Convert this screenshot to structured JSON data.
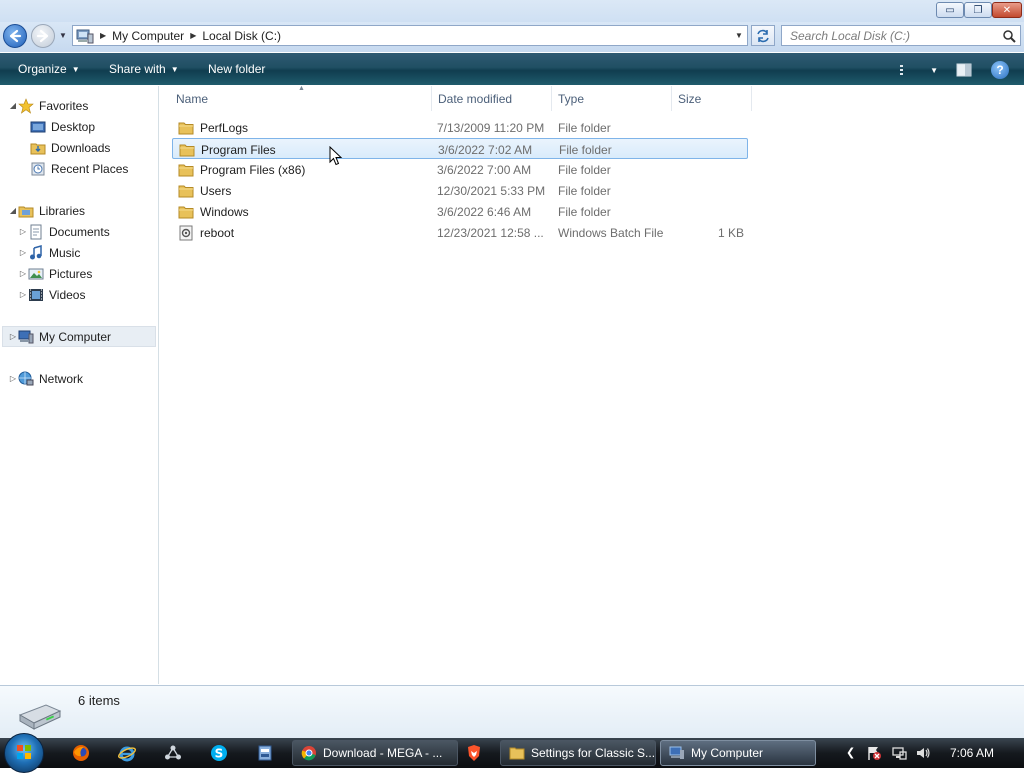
{
  "window": {
    "caption_buttons": {
      "minimize": "▭",
      "maximize": "❐",
      "close": "✕"
    }
  },
  "address_bar": {
    "breadcrumbs": [
      "My Computer",
      "Local Disk (C:)"
    ],
    "search_placeholder": "Search Local Disk (C:)"
  },
  "toolbar": {
    "organize": "Organize",
    "share_with": "Share with",
    "new_folder": "New folder",
    "help": "?"
  },
  "nav_pane": {
    "favorites": {
      "label": "Favorites",
      "items": [
        "Desktop",
        "Downloads",
        "Recent Places"
      ]
    },
    "libraries": {
      "label": "Libraries",
      "items": [
        "Documents",
        "Music",
        "Pictures",
        "Videos"
      ]
    },
    "my_computer": "My Computer",
    "network": "Network"
  },
  "columns": {
    "name": "Name",
    "date_modified": "Date modified",
    "type": "Type",
    "size": "Size"
  },
  "files": [
    {
      "name": "PerfLogs",
      "date": "7/13/2009 11:20 PM",
      "type": "File folder",
      "size": ""
    },
    {
      "name": "Program Files",
      "date": "3/6/2022 7:02 AM",
      "type": "File folder",
      "size": ""
    },
    {
      "name": "Program Files (x86)",
      "date": "3/6/2022 7:00 AM",
      "type": "File folder",
      "size": ""
    },
    {
      "name": "Users",
      "date": "12/30/2021 5:33 PM",
      "type": "File folder",
      "size": ""
    },
    {
      "name": "Windows",
      "date": "3/6/2022 6:46 AM",
      "type": "File folder",
      "size": ""
    },
    {
      "name": "reboot",
      "date": "12/23/2021 12:58 ...",
      "type": "Windows Batch File",
      "size": "1 KB"
    }
  ],
  "status": {
    "items_count": "6 items"
  },
  "taskbar": {
    "buttons": [
      {
        "label": "Download - MEGA - ..."
      },
      {
        "label": "Settings for Classic S..."
      },
      {
        "label": "My Computer"
      }
    ],
    "clock": "7:06 AM",
    "tray_arrow": "❮"
  },
  "colors": {
    "command_bar": "#204f63",
    "selection_border": "#7fb4e9",
    "selection_fill": "#d9ebfb",
    "folder": "#e8c15a"
  }
}
